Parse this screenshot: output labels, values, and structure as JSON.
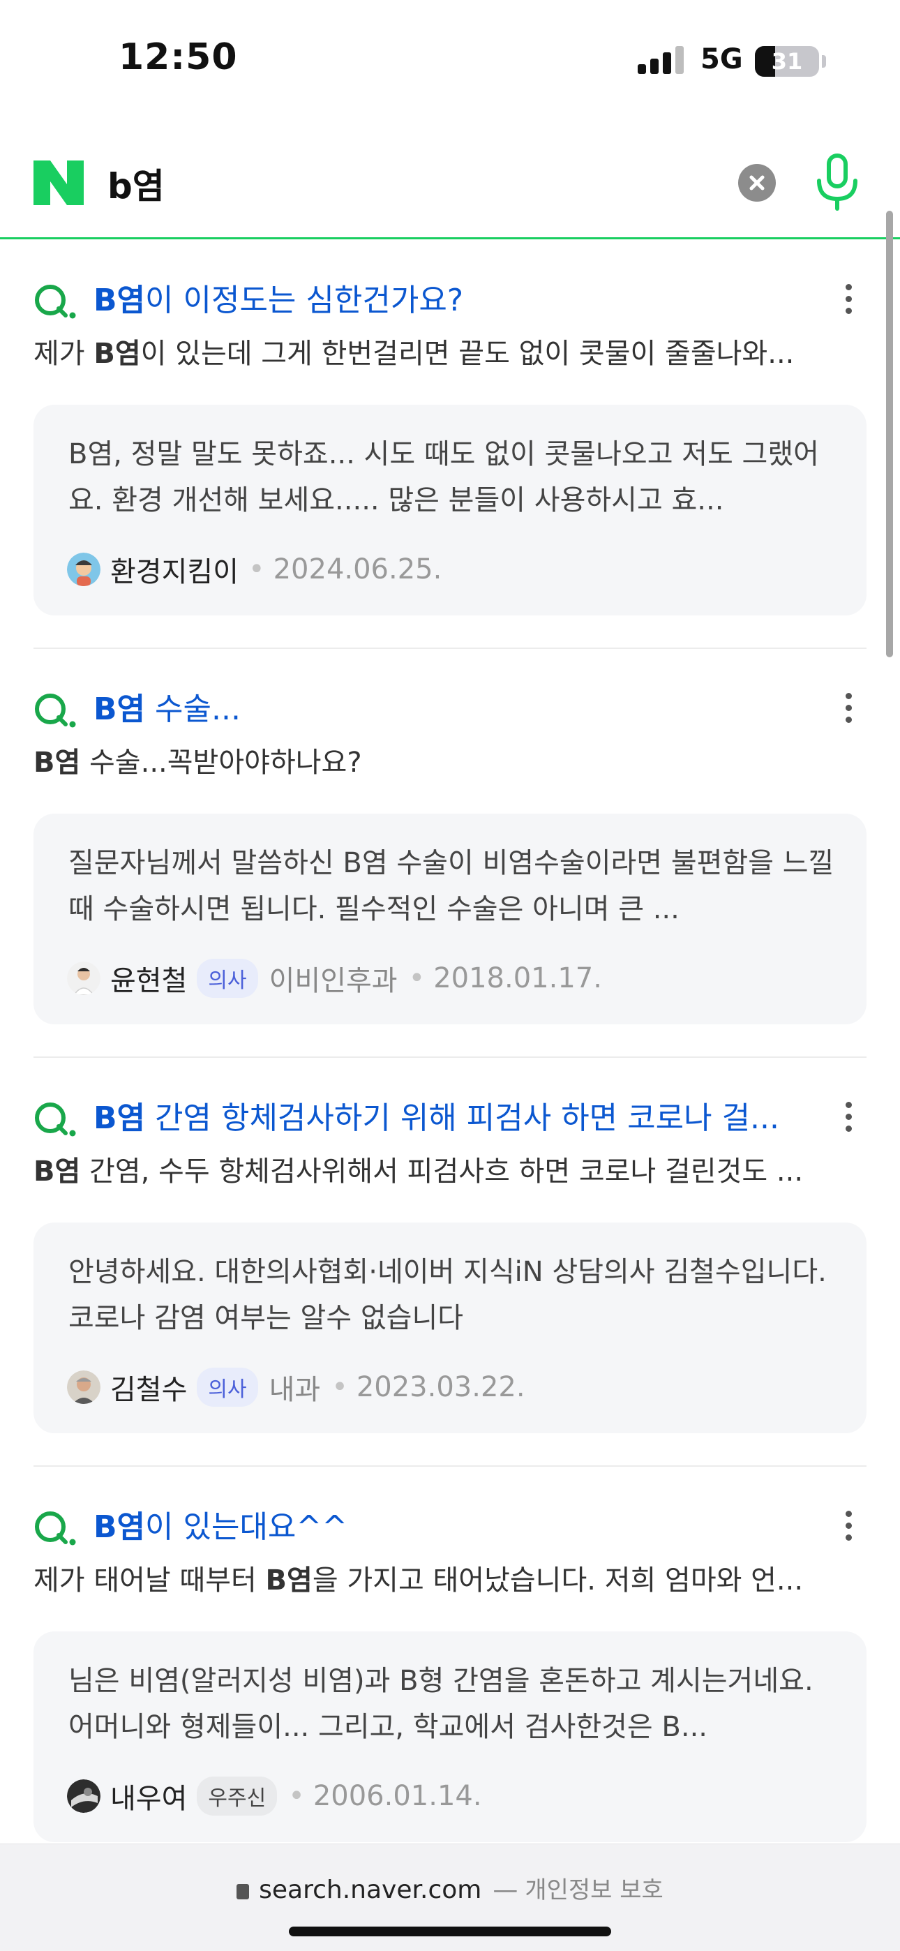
{
  "status_bar": {
    "time": "12:50",
    "network": "5G",
    "battery": "31"
  },
  "search": {
    "query": "b염",
    "logo_letter": "N"
  },
  "results": [
    {
      "title_bold": "B염",
      "title_rest": "이 이정도는 심한건가요?",
      "snippet_pre": "제가 ",
      "snippet_bold": "B염",
      "snippet_post": "이 있는데 그게 한번걸리면 끝도 없이 콧물이 줄줄나와...",
      "answer": "B염, 정말 말도 못하죠... 시도 때도 없이 콧물나오고 저도 그랬어요. 환경 개선해 보세요..... 많은 분들이 사용하시고 효...",
      "author": "환경지킴이",
      "badge": "",
      "dept": "",
      "date": "2024.06.25."
    },
    {
      "title_bold": "B염",
      "title_rest": " 수술...",
      "snippet_pre": "",
      "snippet_bold": "B염",
      "snippet_post": " 수술...꼭받아야하나요?",
      "answer": "질문자님께서 말씀하신 B염 수술이 비염수술이라면 불편함을 느낄 때 수술하시면 됩니다. 필수적인 수술은 아니며 큰 ...",
      "author": "윤현철",
      "badge": "의사",
      "dept": "이비인후과",
      "date": "2018.01.17."
    },
    {
      "title_bold": "B염",
      "title_rest": " 간염 항체검사하기 위해 피검사 하면 코로나 걸...",
      "snippet_pre": "",
      "snippet_bold": "B염",
      "snippet_post": " 간염, 수두 항체검사위해서 피검사흐 하면 코로나 걸린것도 ...",
      "answer": "안녕하세요. 대한의사협회·네이버 지식iN 상담의사 김철수입니다. 코로나 감염 여부는 알수 없습니다",
      "author": "김철수",
      "badge": "의사",
      "dept": "내과",
      "date": "2023.03.22."
    },
    {
      "title_bold": "B염",
      "title_rest": "이 있는대요^^",
      "snippet_pre": "제가 태어날 때부터 ",
      "snippet_bold": "B염",
      "snippet_post": "을 가지고 태어났습니다. 저희 엄마와 언...",
      "answer": "님은 비염(알러지성 비염)과 B형 간염을 혼돈하고 계시는거네요. 어머니와 형제들이... 그리고, 학교에서 검사한것은 B...",
      "author": "내우여",
      "badge": "우주신",
      "dept": "",
      "date": "2006.01.14."
    }
  ],
  "footer": {
    "url": "search.naver.com",
    "separator": "—",
    "privacy": "개인정보 보호"
  },
  "colors": {
    "naver_green": "#19ce60",
    "link_blue": "#0b57d0",
    "q_green": "#19a74a"
  }
}
